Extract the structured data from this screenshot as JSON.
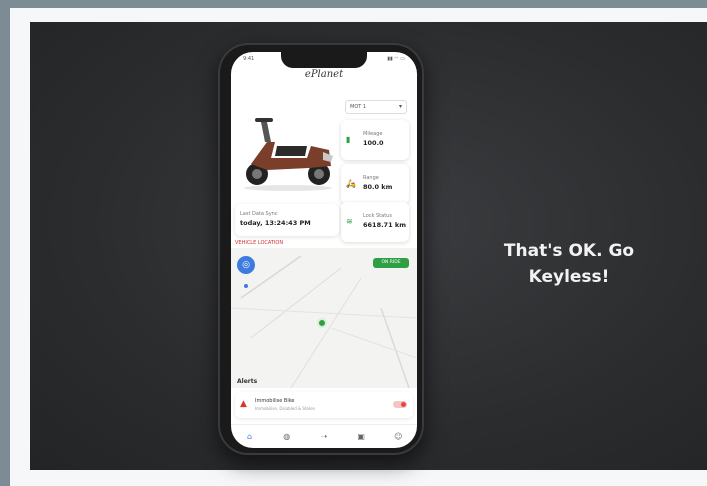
{
  "tagline": {
    "line1": "That's OK. Go",
    "line2": "Keyless!"
  },
  "app": {
    "logo": "ePlanet",
    "status_time": "9:41",
    "status_icons": "▮▮ ◠ ▭",
    "vehicle_select": "MOT 1",
    "stats": [
      {
        "label": "Mileage",
        "value": "100.0",
        "icon": "battery-icon"
      },
      {
        "label": "Range",
        "value": "80.0 km",
        "icon": "scooter-icon"
      },
      {
        "label": "Lock Status",
        "value": "6618.71 km",
        "icon": "signal-icon"
      }
    ],
    "last_sync": {
      "label": "Last Data Sync",
      "value": "today, 13:24:43 PM"
    },
    "vehicle_location": "VEHICLE LOCATION",
    "map_status": "ON RIDE",
    "alerts_title": "Alerts",
    "alert": {
      "title": "Immobilise Bike",
      "subtitle": "Immobilise, Disabled & Stolen"
    },
    "nav": [
      "home-icon",
      "globe-icon",
      "ride-icon",
      "ble-icon",
      "profile-icon"
    ]
  },
  "colors": {
    "accent": "#3d7be0",
    "green": "#2ea043",
    "red": "#e04848"
  }
}
